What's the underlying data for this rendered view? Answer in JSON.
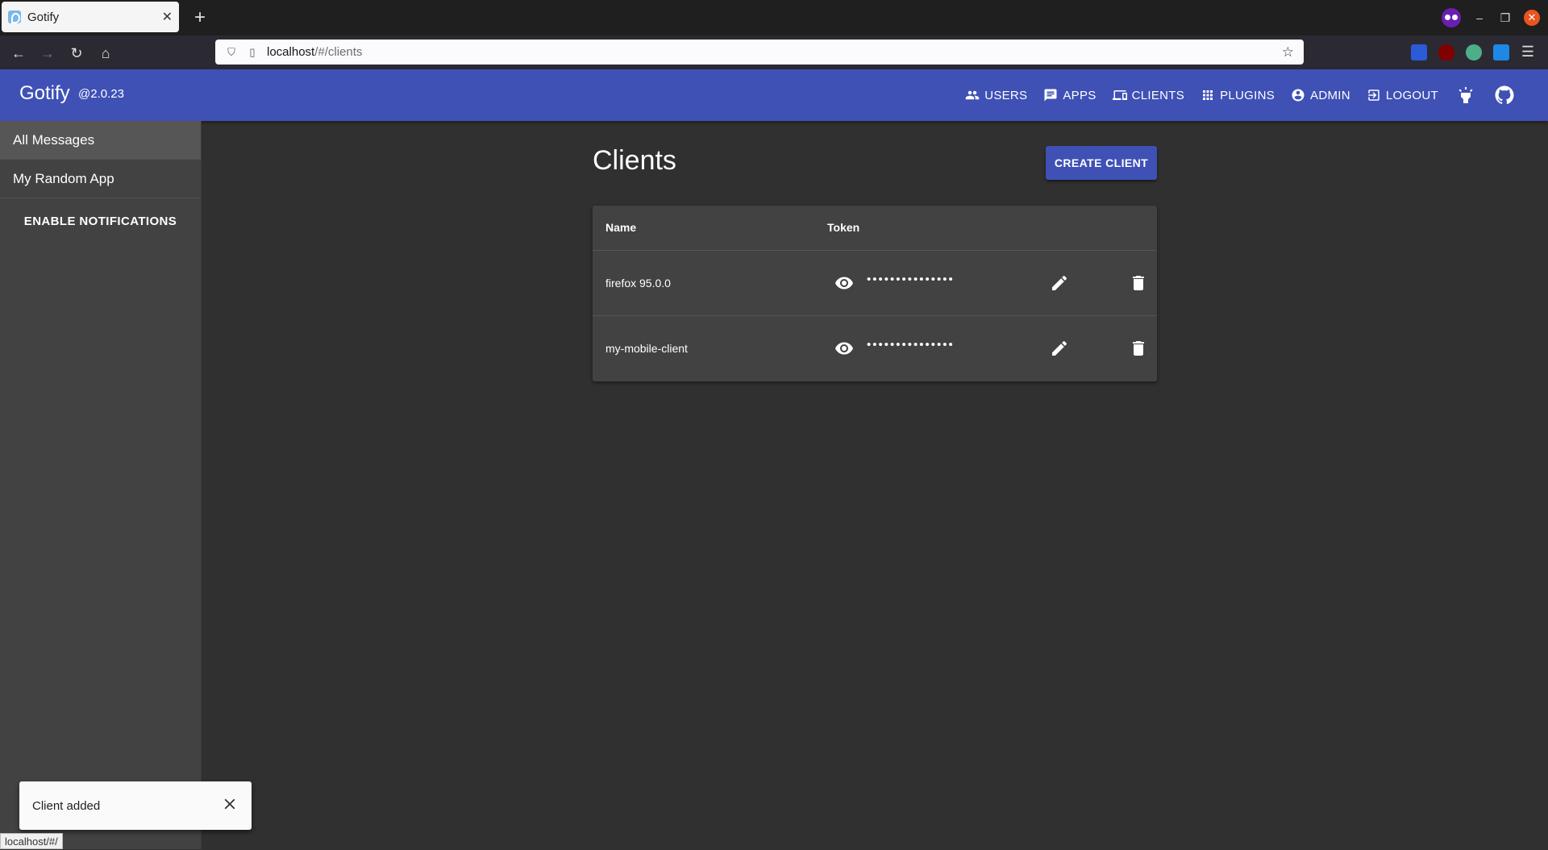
{
  "browser": {
    "tab_title": "Gotify",
    "url_host": "localhost",
    "url_path": "/#/clients",
    "status_url": "localhost/#/"
  },
  "app": {
    "brand": "Gotify",
    "version": "@2.0.23",
    "nav": {
      "users": "USERS",
      "apps": "APPS",
      "clients": "CLIENTS",
      "plugins": "PLUGINS",
      "admin": "ADMIN",
      "logout": "LOGOUT"
    }
  },
  "sidebar": {
    "items": [
      {
        "label": "All Messages"
      },
      {
        "label": "My Random App"
      }
    ],
    "enable_notifications": "ENABLE NOTIFICATIONS"
  },
  "main": {
    "title": "Clients",
    "create_button": "CREATE CLIENT",
    "table": {
      "columns": [
        "Name",
        "Token"
      ],
      "rows": [
        {
          "name": "firefox 95.0.0",
          "token": "•••••••••••••••"
        },
        {
          "name": "my-mobile-client",
          "token": "•••••••••••••••"
        }
      ]
    }
  },
  "snackbar": {
    "message": "Client added"
  },
  "colors": {
    "primary": "#3f51b5",
    "background": "#303030",
    "surface": "#424242"
  }
}
